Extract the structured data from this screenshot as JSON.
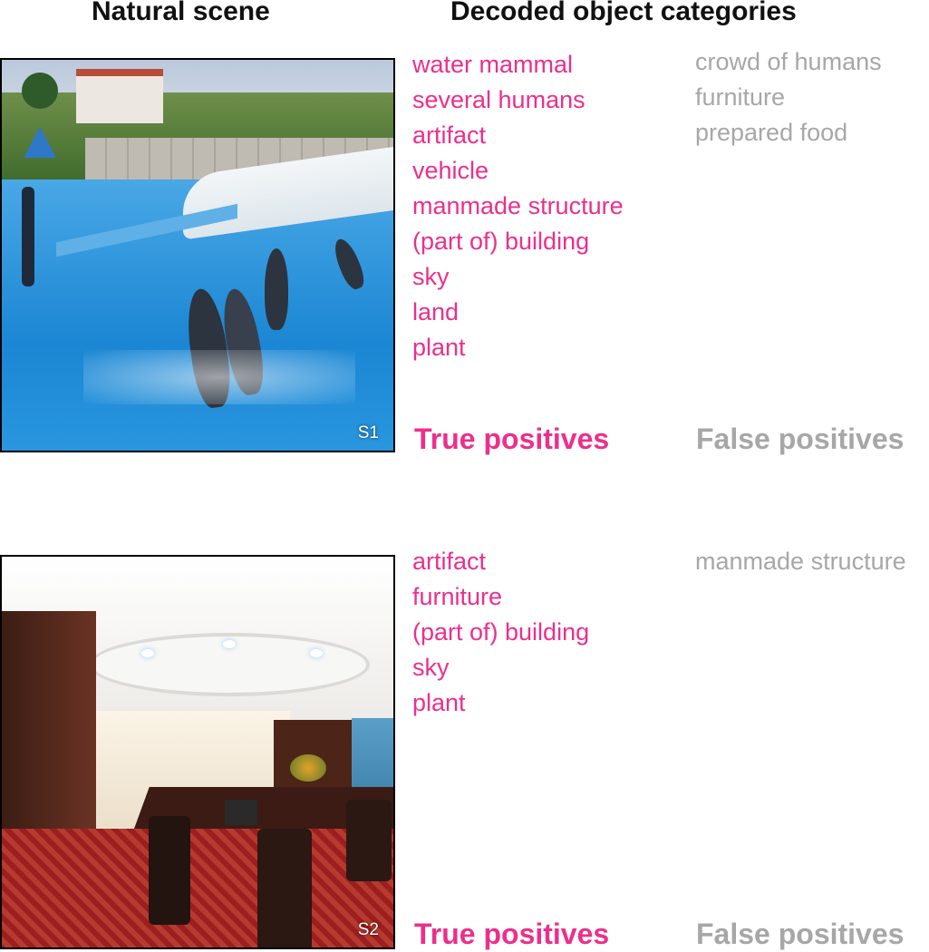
{
  "headers": {
    "natural_scene": "Natural scene",
    "decoded": "Decoded object categories"
  },
  "scenes": [
    {
      "id": "S1",
      "image": "dolphin-show-pool-photo",
      "true_positives": [
        "water mammal",
        "several humans",
        "artifact",
        "vehicle",
        "manmade structure",
        "(part of) building",
        "sky",
        "land",
        "plant"
      ],
      "false_positives": [
        "crowd of humans",
        "furniture",
        "prepared food"
      ],
      "tp_label": "True positives",
      "fp_label": "False positives"
    },
    {
      "id": "S2",
      "image": "conference-room-photo",
      "true_positives": [
        "artifact",
        "furniture",
        "(part of) building",
        "sky",
        "plant"
      ],
      "false_positives": [
        "manmade structure"
      ],
      "tp_label": "True positives",
      "fp_label": "False positives"
    }
  ],
  "colors": {
    "true_positive": "#ec2f8c",
    "false_positive": "#a7a7a7"
  }
}
